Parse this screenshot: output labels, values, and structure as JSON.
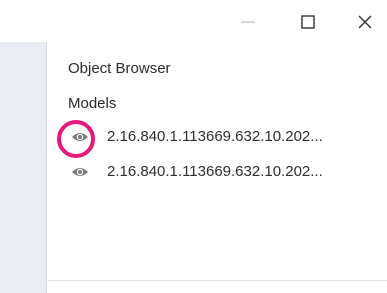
{
  "window": {
    "minimize_icon": "minimize-icon",
    "maximize_icon": "maximize-icon",
    "close_icon": "close-icon"
  },
  "panel": {
    "title": "Object Browser",
    "section_label": "Models"
  },
  "models": [
    {
      "label": "2.16.840.1.113669.632.10.202...",
      "icon": "eye-icon",
      "highlighted": true
    },
    {
      "label": "2.16.840.1.113669.632.10.202...",
      "icon": "eye-icon",
      "highlighted": false
    }
  ],
  "colors": {
    "highlight": "#e8177a",
    "icon": "#7a7a7a",
    "strip": "#e9ecf2"
  }
}
